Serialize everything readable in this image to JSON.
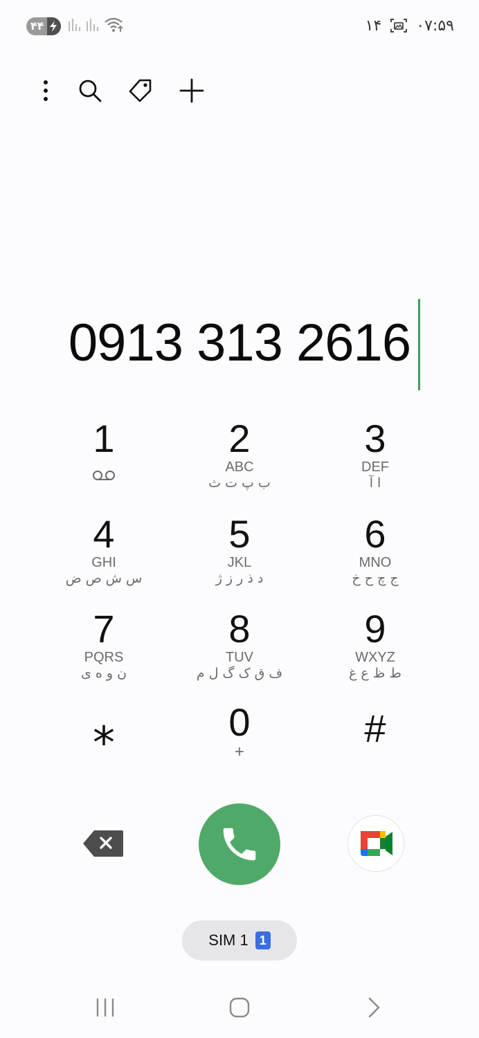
{
  "status_bar": {
    "battery_level": "۴۴",
    "time": "۰۷:۵۹",
    "notification_count": "۱۴",
    "icons": [
      "battery-icon",
      "signal-icon",
      "signal-icon",
      "wifi-icon",
      "screenshot-icon"
    ]
  },
  "toolbar": {
    "icons": [
      "more-options-icon",
      "search-icon",
      "tag-icon",
      "add-icon"
    ]
  },
  "dialer": {
    "number": "0913 313 2616",
    "keys": [
      {
        "digit": "1",
        "letters": "",
        "fa": "",
        "sub_icon": "voicemail-icon"
      },
      {
        "digit": "2",
        "letters": "ABC",
        "fa": "ب پ ت ث"
      },
      {
        "digit": "3",
        "letters": "DEF",
        "fa": "ا آ"
      },
      {
        "digit": "4",
        "letters": "GHI",
        "fa": "س ش ص ض"
      },
      {
        "digit": "5",
        "letters": "JKL",
        "fa": "د ذ ر ز ژ"
      },
      {
        "digit": "6",
        "letters": "MNO",
        "fa": "ج چ ح خ"
      },
      {
        "digit": "7",
        "letters": "PQRS",
        "fa": "ن و ه ی"
      },
      {
        "digit": "8",
        "letters": "TUV",
        "fa": "ف ق ک گ ل م"
      },
      {
        "digit": "9",
        "letters": "WXYZ",
        "fa": "ط ظ ع غ"
      },
      {
        "digit": "⁎",
        "letters": "",
        "fa": ""
      },
      {
        "digit": "0",
        "letters": "",
        "fa": "",
        "sub": "+"
      },
      {
        "digit": "#",
        "letters": "",
        "fa": ""
      }
    ]
  },
  "actions": {
    "icons": [
      "backspace-icon",
      "phone-icon",
      "google-meet-icon"
    ]
  },
  "sim": {
    "label": "SIM 1",
    "badge": "1"
  },
  "nav_bar": {
    "icons": [
      "recent-apps-icon",
      "home-icon",
      "back-icon"
    ]
  },
  "colors": {
    "call_green": "#4faa6a",
    "cursor_green": "#3f9b5c",
    "sim_badge_blue": "#3c6ee0"
  }
}
